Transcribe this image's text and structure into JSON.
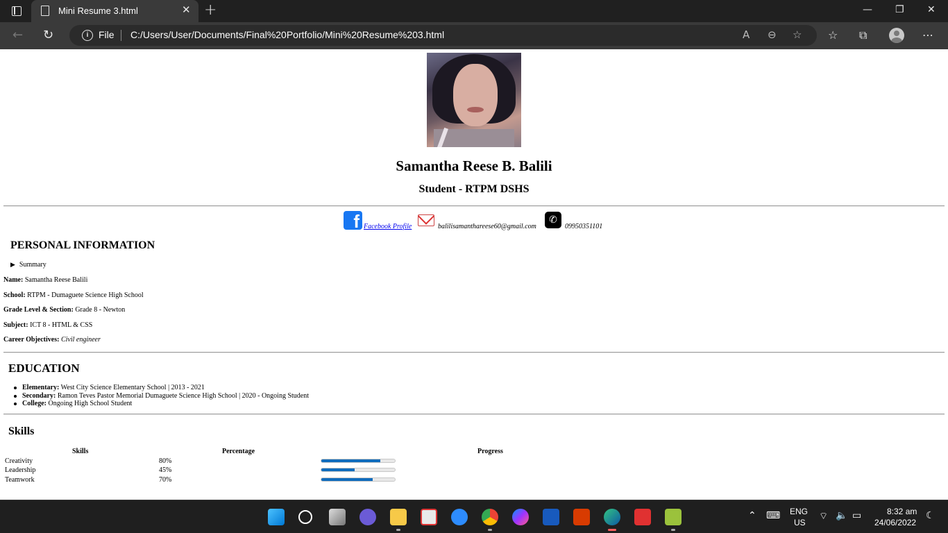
{
  "browser": {
    "tab_title": "Mini Resume 3.html",
    "address_scheme": "File",
    "address_url": "C:/Users/User/Documents/Final%20Portfolio/Mini%20Resume%203.html"
  },
  "resume": {
    "name": "Samantha Reese B. Balili",
    "subtitle": "Student - RTPM DSHS",
    "contact": {
      "facebook_label": "Facebook Profile",
      "email": "balilisamanthareese60@gmail.com",
      "phone": "09950351101"
    },
    "personal": {
      "heading": "PERSONAL INFORMATION",
      "summary_label": "Summary",
      "fields": [
        {
          "label": "Name:",
          "value": "Samantha Reese Balili"
        },
        {
          "label": "School:",
          "value": "RTPM - Dumaguete Science High School"
        },
        {
          "label": "Grade Level & Section:",
          "value": "Grade 8 - Newton"
        },
        {
          "label": "Subject:",
          "value": "ICT 8 - HTML & CSS"
        },
        {
          "label": "Career Objectives:",
          "value": "Civil engineer"
        }
      ]
    },
    "education": {
      "heading": "EDUCATION",
      "items": [
        {
          "label": "Elementary:",
          "value": "West City Science Elementary School | 2013 - 2021"
        },
        {
          "label": "Secondary:",
          "value": "Ramon Teves Pastor Memorial Dumaguete Science High School | 2020 - Ongoing Student"
        },
        {
          "label": "College:",
          "value": "Ongoing High School Student"
        }
      ]
    },
    "skills": {
      "heading": "Skills",
      "columns": [
        "Skills",
        "Percentage",
        "Progress"
      ],
      "rows": [
        {
          "skill": "Creativity",
          "percent": "80%",
          "progress": 0.8
        },
        {
          "skill": "Leadership",
          "percent": "45%",
          "progress": 0.45
        },
        {
          "skill": "Teamwork",
          "percent": "70%",
          "progress": 0.7
        }
      ]
    }
  },
  "taskbar": {
    "lang_top": "ENG",
    "lang_bottom": "US",
    "time": "8:32 am",
    "date": "24/06/2022"
  },
  "colors": {
    "accent": "#0f6cbd",
    "facebook": "#1877f2"
  }
}
